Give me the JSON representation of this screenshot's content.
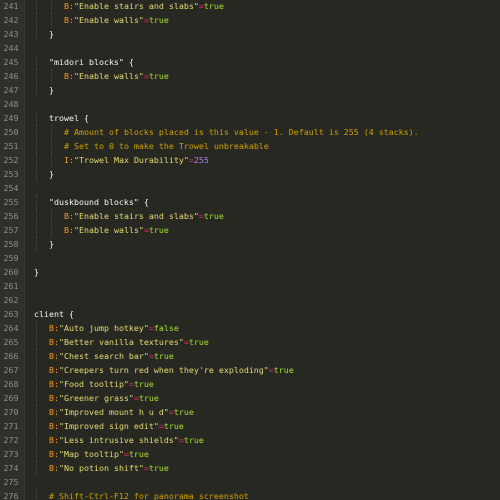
{
  "editor": {
    "lines": [
      {
        "num": "241",
        "indent": 4,
        "tokens": [
          {
            "cls": "k",
            "text": "B:"
          },
          {
            "cls": "s",
            "text": "\"Enable stairs and slabs\""
          },
          {
            "cls": "o",
            "text": "="
          },
          {
            "cls": "t",
            "text": "true"
          }
        ]
      },
      {
        "num": "242",
        "indent": 4,
        "tokens": [
          {
            "cls": "k",
            "text": "B:"
          },
          {
            "cls": "s",
            "text": "\"Enable walls\""
          },
          {
            "cls": "o",
            "text": "="
          },
          {
            "cls": "t",
            "text": "true"
          }
        ]
      },
      {
        "num": "243",
        "indent": 2,
        "tokens": [
          {
            "cls": "p",
            "text": "}"
          }
        ]
      },
      {
        "num": "244",
        "indent": 0,
        "tokens": []
      },
      {
        "num": "245",
        "indent": 2,
        "tokens": [
          {
            "cls": "p",
            "text": "\"midori blocks\" {"
          }
        ]
      },
      {
        "num": "246",
        "indent": 4,
        "tokens": [
          {
            "cls": "k",
            "text": "B:"
          },
          {
            "cls": "s",
            "text": "\"Enable walls\""
          },
          {
            "cls": "o",
            "text": "="
          },
          {
            "cls": "t",
            "text": "true"
          }
        ]
      },
      {
        "num": "247",
        "indent": 2,
        "tokens": [
          {
            "cls": "p",
            "text": "}"
          }
        ]
      },
      {
        "num": "248",
        "indent": 0,
        "tokens": []
      },
      {
        "num": "249",
        "indent": 2,
        "tokens": [
          {
            "cls": "p",
            "text": "trowel {"
          }
        ]
      },
      {
        "num": "250",
        "indent": 4,
        "tokens": [
          {
            "cls": "c",
            "text": "# Amount of blocks placed is this value - 1. Default is 255 (4 stacks)."
          }
        ]
      },
      {
        "num": "251",
        "indent": 4,
        "tokens": [
          {
            "cls": "c",
            "text": "# Set to 0 to make the Trowel unbreakable"
          }
        ]
      },
      {
        "num": "252",
        "indent": 4,
        "tokens": [
          {
            "cls": "k",
            "text": "I:"
          },
          {
            "cls": "s",
            "text": "\"Trowel Max Durability\""
          },
          {
            "cls": "o",
            "text": "="
          },
          {
            "cls": "n",
            "text": "255"
          }
        ]
      },
      {
        "num": "253",
        "indent": 2,
        "tokens": [
          {
            "cls": "p",
            "text": "}"
          }
        ]
      },
      {
        "num": "254",
        "indent": 0,
        "tokens": []
      },
      {
        "num": "255",
        "indent": 2,
        "tokens": [
          {
            "cls": "p",
            "text": "\"duskbound blocks\" {"
          }
        ]
      },
      {
        "num": "256",
        "indent": 4,
        "tokens": [
          {
            "cls": "k",
            "text": "B:"
          },
          {
            "cls": "s",
            "text": "\"Enable stairs and slabs\""
          },
          {
            "cls": "o",
            "text": "="
          },
          {
            "cls": "t",
            "text": "true"
          }
        ]
      },
      {
        "num": "257",
        "indent": 4,
        "tokens": [
          {
            "cls": "k",
            "text": "B:"
          },
          {
            "cls": "s",
            "text": "\"Enable walls\""
          },
          {
            "cls": "o",
            "text": "="
          },
          {
            "cls": "t",
            "text": "true"
          }
        ]
      },
      {
        "num": "258",
        "indent": 2,
        "tokens": [
          {
            "cls": "p",
            "text": "}"
          }
        ]
      },
      {
        "num": "259",
        "indent": 0,
        "tokens": []
      },
      {
        "num": "260",
        "indent": 0,
        "tokens": [
          {
            "cls": "p",
            "text": "}"
          }
        ]
      },
      {
        "num": "261",
        "indent": 0,
        "tokens": []
      },
      {
        "num": "262",
        "indent": 0,
        "tokens": []
      },
      {
        "num": "263",
        "indent": 0,
        "tokens": [
          {
            "cls": "p",
            "text": "client {"
          }
        ]
      },
      {
        "num": "264",
        "indent": 2,
        "tokens": [
          {
            "cls": "k",
            "text": "B:"
          },
          {
            "cls": "s",
            "text": "\"Auto jump hotkey\""
          },
          {
            "cls": "o",
            "text": "="
          },
          {
            "cls": "t",
            "text": "false"
          }
        ]
      },
      {
        "num": "265",
        "indent": 2,
        "tokens": [
          {
            "cls": "k",
            "text": "B:"
          },
          {
            "cls": "s",
            "text": "\"Better vanilla textures\""
          },
          {
            "cls": "o",
            "text": "="
          },
          {
            "cls": "t",
            "text": "true"
          }
        ]
      },
      {
        "num": "266",
        "indent": 2,
        "tokens": [
          {
            "cls": "k",
            "text": "B:"
          },
          {
            "cls": "s",
            "text": "\"Chest search bar\""
          },
          {
            "cls": "o",
            "text": "="
          },
          {
            "cls": "t",
            "text": "true"
          }
        ]
      },
      {
        "num": "267",
        "indent": 2,
        "tokens": [
          {
            "cls": "k",
            "text": "B:"
          },
          {
            "cls": "s",
            "text": "\"Creepers turn red when they're exploding\""
          },
          {
            "cls": "o",
            "text": "="
          },
          {
            "cls": "t",
            "text": "true"
          }
        ]
      },
      {
        "num": "268",
        "indent": 2,
        "tokens": [
          {
            "cls": "k",
            "text": "B:"
          },
          {
            "cls": "s",
            "text": "\"Food tooltip\""
          },
          {
            "cls": "o",
            "text": "="
          },
          {
            "cls": "t",
            "text": "true"
          }
        ]
      },
      {
        "num": "269",
        "indent": 2,
        "tokens": [
          {
            "cls": "k",
            "text": "B:"
          },
          {
            "cls": "s",
            "text": "\"Greener grass\""
          },
          {
            "cls": "o",
            "text": "="
          },
          {
            "cls": "t",
            "text": "true"
          }
        ]
      },
      {
        "num": "270",
        "indent": 2,
        "tokens": [
          {
            "cls": "k",
            "text": "B:"
          },
          {
            "cls": "s",
            "text": "\"Improved mount h u d\""
          },
          {
            "cls": "o",
            "text": "="
          },
          {
            "cls": "t",
            "text": "true"
          }
        ]
      },
      {
        "num": "271",
        "indent": 2,
        "tokens": [
          {
            "cls": "k",
            "text": "B:"
          },
          {
            "cls": "s",
            "text": "\"Improved sign edit\""
          },
          {
            "cls": "o",
            "text": "="
          },
          {
            "cls": "t",
            "text": "true"
          }
        ]
      },
      {
        "num": "272",
        "indent": 2,
        "tokens": [
          {
            "cls": "k",
            "text": "B:"
          },
          {
            "cls": "s",
            "text": "\"Less intrusive shields\""
          },
          {
            "cls": "o",
            "text": "="
          },
          {
            "cls": "t",
            "text": "true"
          }
        ]
      },
      {
        "num": "273",
        "indent": 2,
        "tokens": [
          {
            "cls": "k",
            "text": "B:"
          },
          {
            "cls": "s",
            "text": "\"Map tooltip\""
          },
          {
            "cls": "o",
            "text": "="
          },
          {
            "cls": "t",
            "text": "true"
          }
        ]
      },
      {
        "num": "274",
        "indent": 2,
        "tokens": [
          {
            "cls": "k",
            "text": "B:"
          },
          {
            "cls": "s",
            "text": "\"No potion shift\""
          },
          {
            "cls": "o",
            "text": "="
          },
          {
            "cls": "t",
            "text": "true"
          }
        ]
      },
      {
        "num": "275",
        "indent": 0,
        "tokens": []
      },
      {
        "num": "276",
        "indent": 2,
        "tokens": [
          {
            "cls": "c",
            "text": "# Shift-Ctrl-F12 for panorama screenshot"
          }
        ]
      }
    ]
  },
  "colors": {
    "background": "#272822",
    "gutter": "#2f302a",
    "line_number": "#8f908a",
    "key_prefix": "#fd971f",
    "string": "#e6db74",
    "operator": "#f92672",
    "boolean": "#a6e22e",
    "number": "#ae81ff",
    "comment": "#cfa000",
    "plain": "#f8f8f2"
  }
}
